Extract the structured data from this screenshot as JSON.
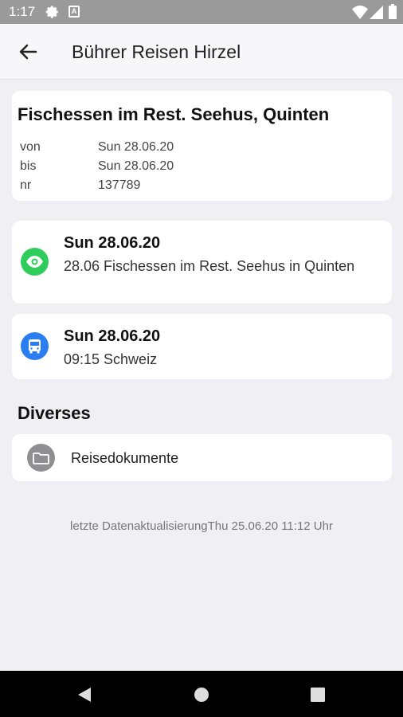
{
  "status_bar": {
    "time": "1:17",
    "a_badge": "A"
  },
  "app_bar": {
    "title": "Bührer Reisen Hirzel",
    "back_icon": "arrow-left-icon"
  },
  "trip": {
    "title": "Fischessen im Rest. Seehus, Quinten",
    "rows": [
      {
        "label": "von",
        "value": "Sun 28.06.20"
      },
      {
        "label": "bis",
        "value": "Sun 28.06.20"
      },
      {
        "label": "nr",
        "value": "137789"
      }
    ]
  },
  "events": [
    {
      "icon": "eye-icon",
      "color": "#2ecc5a",
      "date": "Sun 28.06.20",
      "text": "28.06 Fischessen im Rest. Seehus in Quinten"
    },
    {
      "icon": "bus-icon",
      "color": "#2a7ef0",
      "date": "Sun 28.06.20",
      "text": "09:15 Schweiz"
    }
  ],
  "diverses": {
    "title": "Diverses",
    "items": [
      {
        "icon": "folder-icon",
        "label": "Reisedokumente"
      }
    ]
  },
  "footer": {
    "last_update": "letzte DatenaktualisierungThu 25.06.20 11:12 Uhr"
  },
  "nav": {
    "back": "nav-back-icon",
    "home": "nav-home-icon",
    "recents": "nav-recents-icon"
  }
}
